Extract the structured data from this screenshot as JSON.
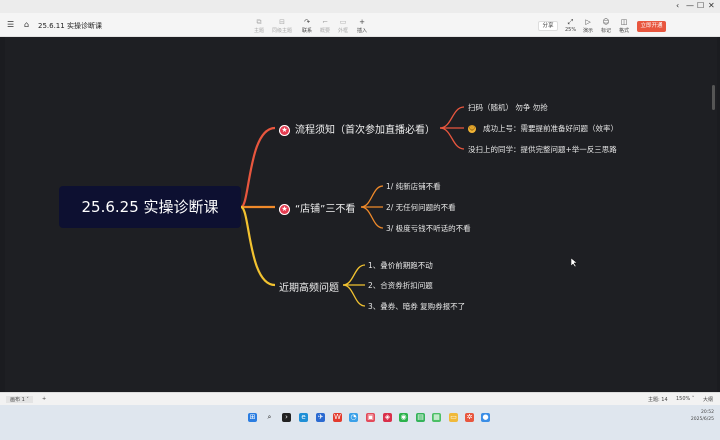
{
  "window": {
    "controls": [
      "‹",
      "—",
      "☐",
      "✕"
    ]
  },
  "toolbar": {
    "doc_title": "25.6.11 实操诊断课",
    "items": [
      {
        "label": "主题",
        "icon": "⧉"
      },
      {
        "label": "同级主题",
        "icon": "⊟"
      },
      {
        "label": "联系",
        "icon": "↷"
      },
      {
        "label": "概要",
        "icon": "⌐"
      },
      {
        "label": "外框",
        "icon": "▭"
      },
      {
        "label": "插入",
        "icon": "+"
      }
    ],
    "share": "分享",
    "right_items": [
      {
        "label": "25%",
        "icon": "⤢"
      },
      {
        "label": "演示",
        "icon": "▷"
      },
      {
        "label": "标记",
        "icon": "☺"
      },
      {
        "label": "格式",
        "icon": "◫"
      }
    ],
    "member": "立即开通"
  },
  "mindmap": {
    "root": "25.6.25 实操诊断课",
    "branches": [
      {
        "title": "流程须知（首次参加直播必看）",
        "children": [
          "扫码（随机） 勿争 勿抢",
          "成功上号：需要提前准备好问题（效率）",
          "没扫上的同学：提供完整问题+举一反三思路"
        ]
      },
      {
        "title": "“店铺”三不看",
        "children": [
          "1/ 纯新店铺不看",
          "2/ 无任何问题的不看",
          "3/ 极度亏钱不听话的不看"
        ]
      },
      {
        "title": "近期高频问题",
        "children": [
          "1、叠价前期跑不动",
          "2、合资券折扣问题",
          "3、叠券、暗券 复购券报不了"
        ]
      }
    ],
    "colors": {
      "branch1": "#e8563e",
      "branch2": "#f08a2a",
      "branch3": "#f2c230"
    }
  },
  "status": {
    "sheet_tab": "画布 1",
    "sheet_tab_arrow": "˅",
    "add_sheet": "+",
    "topic_count": "主题: 14",
    "zoom": "150%",
    "zoom_arrow": "˅",
    "view": "大纲"
  },
  "taskbar": {
    "icons": [
      "start-icon",
      "search-icon",
      "terminal-icon",
      "edge-icon",
      "app-icon",
      "wps-icon",
      "qq-icon",
      "app-red-icon",
      "app-red2-icon",
      "wechat-icon",
      "chat-icon",
      "app-green-icon",
      "folder-icon",
      "xmind-icon",
      "app-blue-icon"
    ],
    "time": "20:52",
    "date": "2025/6/25"
  }
}
